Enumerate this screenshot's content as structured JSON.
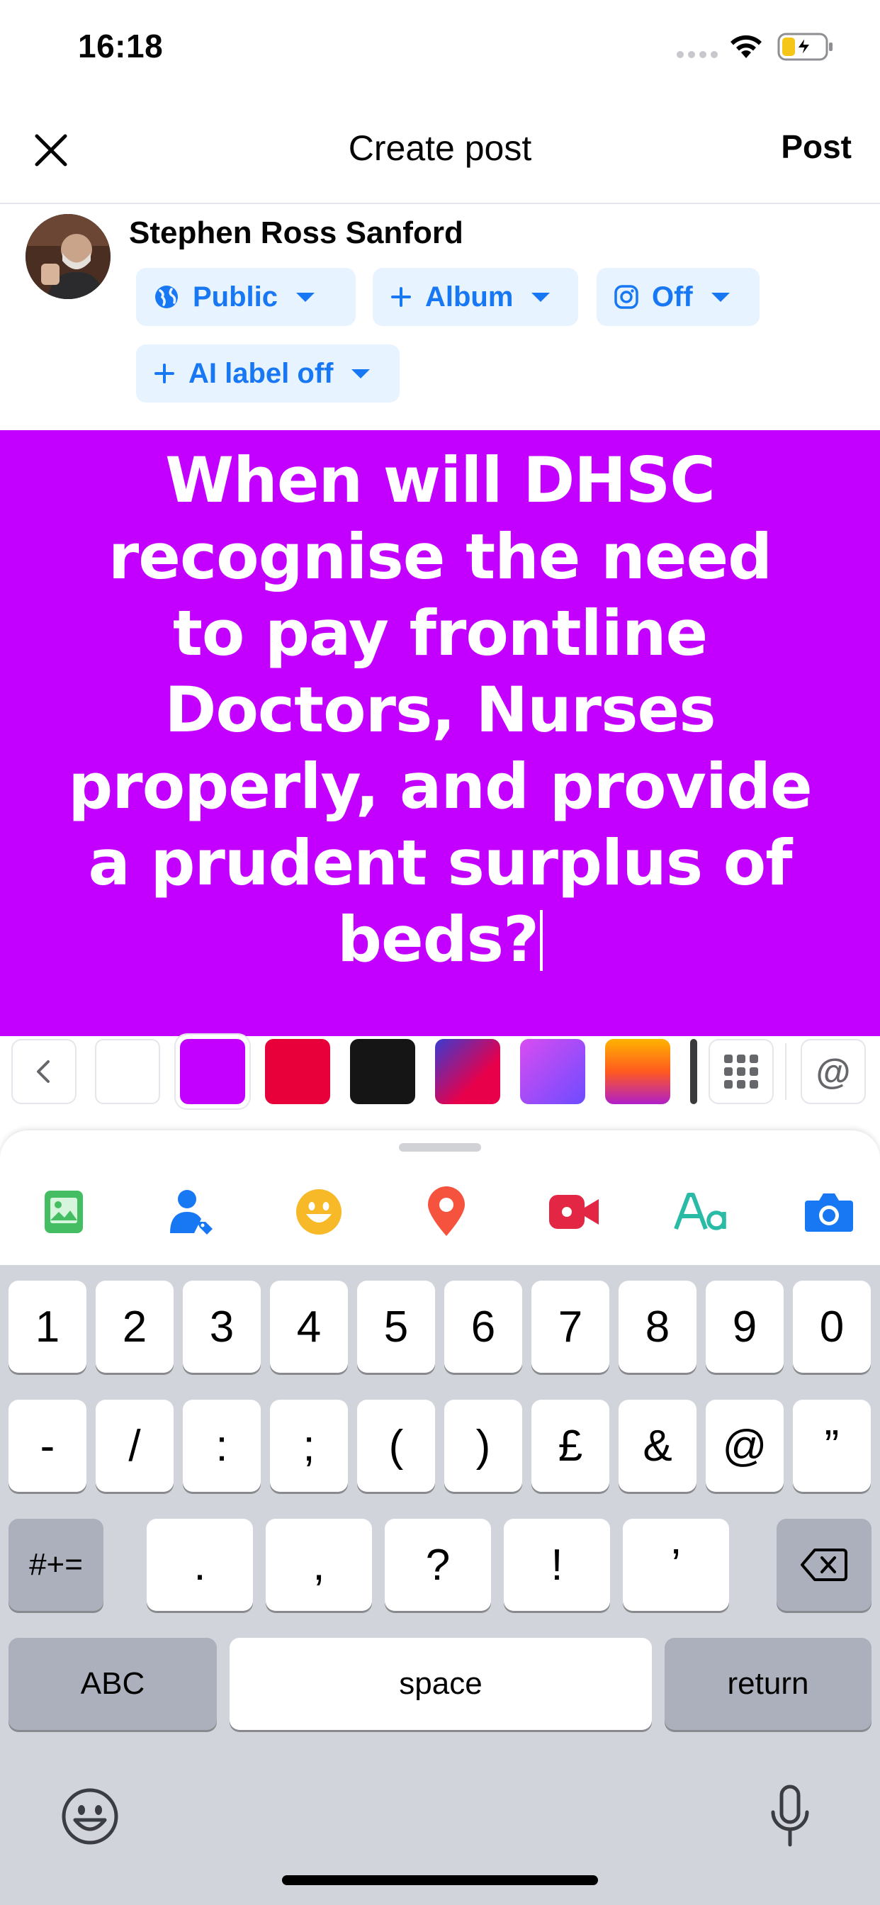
{
  "status_bar": {
    "time": "16:18",
    "wifi_icon": "wifi-icon",
    "battery_icon": "battery-charging-icon",
    "battery_color": "#f5c518"
  },
  "header": {
    "close_icon": "close-icon",
    "title": "Create post",
    "post_label": "Post"
  },
  "author": {
    "name": "Stephen Ross Sanford",
    "chips": {
      "audience": {
        "label": "Public",
        "icon": "globe-icon"
      },
      "album": {
        "label": "Album",
        "icon": "plus-icon"
      },
      "instagram": {
        "label": "Off",
        "icon": "instagram-icon"
      },
      "ai_label": {
        "label": "AI label off",
        "icon": "plus-icon"
      }
    }
  },
  "composer": {
    "background_color": "#c300ff",
    "text": "When will DHSC recognise the need to pay frontline Doctors, Nurses properly, and provide a prudent surplus of beds?"
  },
  "background_picker": {
    "swatches": [
      "#ffffff",
      "#c300ff",
      "#e8003a",
      "#151515",
      "gradient-red-blue",
      "gradient-purple",
      "gradient-orange"
    ],
    "selected_index": 1,
    "at_label": "@"
  },
  "attachment_tools": [
    "photo-icon",
    "tag-people-icon",
    "feeling-icon",
    "location-icon",
    "live-video-icon",
    "text-style-icon",
    "camera-icon"
  ],
  "keyboard": {
    "row1": [
      "1",
      "2",
      "3",
      "4",
      "5",
      "6",
      "7",
      "8",
      "9",
      "0"
    ],
    "row2": [
      "-",
      "/",
      ":",
      ";",
      "(",
      ")",
      "£",
      "&",
      "@",
      "”"
    ],
    "row3_left": "#+=",
    "row3": [
      ".",
      ",",
      "?",
      "!",
      "’"
    ],
    "abc": "ABC",
    "space": "space",
    "return": "return"
  }
}
